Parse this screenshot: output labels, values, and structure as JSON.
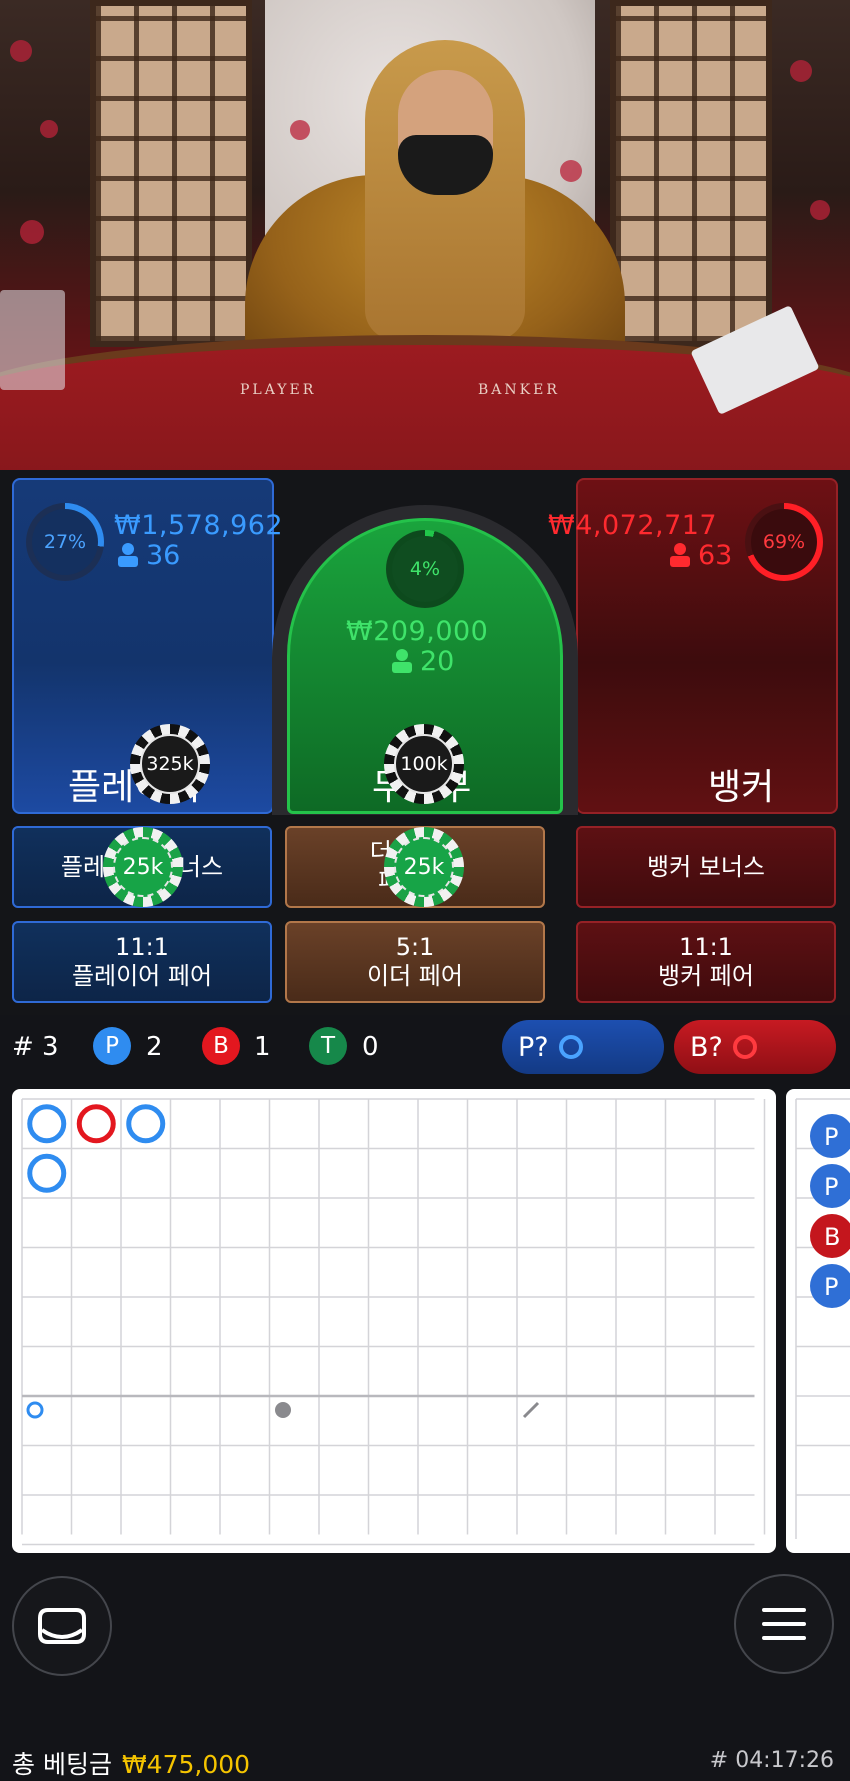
{
  "video": {
    "felt_player_label": "PLAYER",
    "felt_banker_label": "BANKER"
  },
  "player": {
    "percent": "27%",
    "percent_value": 27,
    "amount": "₩1,578,962",
    "count": "36",
    "label": "플레이어",
    "chip": "325k"
  },
  "tie": {
    "percent": "4%",
    "percent_value": 4,
    "amount": "₩209,000",
    "count": "20",
    "label": "무승부",
    "chip": "100k"
  },
  "banker": {
    "percent": "69%",
    "percent_value": 69,
    "amount": "₩4,072,717",
    "count": "63",
    "label": "뱅커"
  },
  "side_bets": [
    {
      "line1": "플레이어 보너스",
      "line2": "",
      "chip": "25k"
    },
    {
      "line1": "더블 1:1",
      "line2": "페어 어",
      "chip": "25k"
    },
    {
      "line1": "뱅커 보너스",
      "line2": ""
    },
    {
      "line1": "11:1",
      "line2": "플레이어 페어"
    },
    {
      "line1": "5:1",
      "line2": "이더 페어"
    },
    {
      "line1": "11:1",
      "line2": "뱅커 페어"
    }
  ],
  "stats": {
    "round_label": "# 3",
    "p_letter": "P",
    "p_count": "2",
    "b_letter": "B",
    "b_count": "1",
    "t_letter": "T",
    "t_count": "0",
    "p_predict": "P?",
    "b_predict": "B?"
  },
  "road": {
    "results": [
      "P",
      "B",
      "P",
      "P"
    ]
  },
  "road_side": [
    "P",
    "P",
    "B",
    "P"
  ],
  "footer": {
    "total_label": "총 베팅금",
    "total_amount": "₩475,000",
    "round_id": "# 04:17:26"
  },
  "colors": {
    "player": "#2f8cf0",
    "banker": "#e3171f",
    "tie": "#21c74a",
    "total": "#f5c400"
  },
  "icons": [
    "person-icon",
    "lobby-icon",
    "menu-icon",
    "hollow-circle-icon"
  ]
}
